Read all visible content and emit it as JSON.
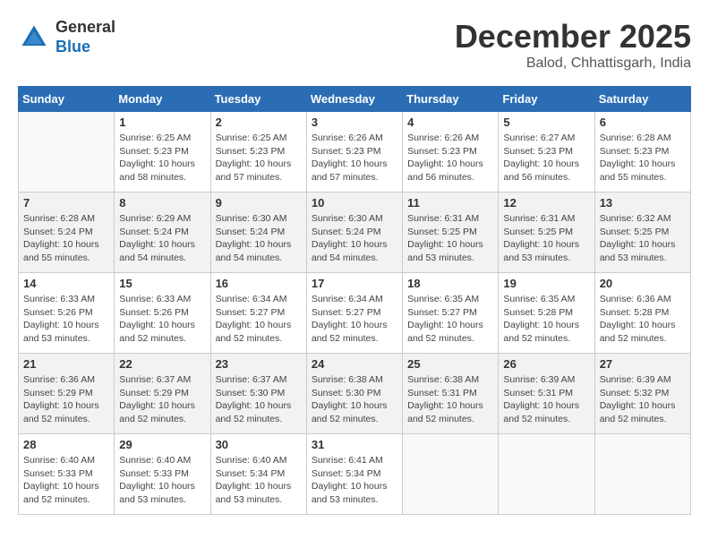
{
  "logo": {
    "general": "General",
    "blue": "Blue"
  },
  "title": {
    "month_year": "December 2025",
    "location": "Balod, Chhattisgarh, India"
  },
  "headers": [
    "Sunday",
    "Monday",
    "Tuesday",
    "Wednesday",
    "Thursday",
    "Friday",
    "Saturday"
  ],
  "weeks": [
    [
      {
        "day": "",
        "sunrise": "",
        "sunset": "",
        "daylight": ""
      },
      {
        "day": "1",
        "sunrise": "Sunrise: 6:25 AM",
        "sunset": "Sunset: 5:23 PM",
        "daylight": "Daylight: 10 hours and 58 minutes."
      },
      {
        "day": "2",
        "sunrise": "Sunrise: 6:25 AM",
        "sunset": "Sunset: 5:23 PM",
        "daylight": "Daylight: 10 hours and 57 minutes."
      },
      {
        "day": "3",
        "sunrise": "Sunrise: 6:26 AM",
        "sunset": "Sunset: 5:23 PM",
        "daylight": "Daylight: 10 hours and 57 minutes."
      },
      {
        "day": "4",
        "sunrise": "Sunrise: 6:26 AM",
        "sunset": "Sunset: 5:23 PM",
        "daylight": "Daylight: 10 hours and 56 minutes."
      },
      {
        "day": "5",
        "sunrise": "Sunrise: 6:27 AM",
        "sunset": "Sunset: 5:23 PM",
        "daylight": "Daylight: 10 hours and 56 minutes."
      },
      {
        "day": "6",
        "sunrise": "Sunrise: 6:28 AM",
        "sunset": "Sunset: 5:23 PM",
        "daylight": "Daylight: 10 hours and 55 minutes."
      }
    ],
    [
      {
        "day": "7",
        "sunrise": "Sunrise: 6:28 AM",
        "sunset": "Sunset: 5:24 PM",
        "daylight": "Daylight: 10 hours and 55 minutes."
      },
      {
        "day": "8",
        "sunrise": "Sunrise: 6:29 AM",
        "sunset": "Sunset: 5:24 PM",
        "daylight": "Daylight: 10 hours and 54 minutes."
      },
      {
        "day": "9",
        "sunrise": "Sunrise: 6:30 AM",
        "sunset": "Sunset: 5:24 PM",
        "daylight": "Daylight: 10 hours and 54 minutes."
      },
      {
        "day": "10",
        "sunrise": "Sunrise: 6:30 AM",
        "sunset": "Sunset: 5:24 PM",
        "daylight": "Daylight: 10 hours and 54 minutes."
      },
      {
        "day": "11",
        "sunrise": "Sunrise: 6:31 AM",
        "sunset": "Sunset: 5:25 PM",
        "daylight": "Daylight: 10 hours and 53 minutes."
      },
      {
        "day": "12",
        "sunrise": "Sunrise: 6:31 AM",
        "sunset": "Sunset: 5:25 PM",
        "daylight": "Daylight: 10 hours and 53 minutes."
      },
      {
        "day": "13",
        "sunrise": "Sunrise: 6:32 AM",
        "sunset": "Sunset: 5:25 PM",
        "daylight": "Daylight: 10 hours and 53 minutes."
      }
    ],
    [
      {
        "day": "14",
        "sunrise": "Sunrise: 6:33 AM",
        "sunset": "Sunset: 5:26 PM",
        "daylight": "Daylight: 10 hours and 53 minutes."
      },
      {
        "day": "15",
        "sunrise": "Sunrise: 6:33 AM",
        "sunset": "Sunset: 5:26 PM",
        "daylight": "Daylight: 10 hours and 52 minutes."
      },
      {
        "day": "16",
        "sunrise": "Sunrise: 6:34 AM",
        "sunset": "Sunset: 5:27 PM",
        "daylight": "Daylight: 10 hours and 52 minutes."
      },
      {
        "day": "17",
        "sunrise": "Sunrise: 6:34 AM",
        "sunset": "Sunset: 5:27 PM",
        "daylight": "Daylight: 10 hours and 52 minutes."
      },
      {
        "day": "18",
        "sunrise": "Sunrise: 6:35 AM",
        "sunset": "Sunset: 5:27 PM",
        "daylight": "Daylight: 10 hours and 52 minutes."
      },
      {
        "day": "19",
        "sunrise": "Sunrise: 6:35 AM",
        "sunset": "Sunset: 5:28 PM",
        "daylight": "Daylight: 10 hours and 52 minutes."
      },
      {
        "day": "20",
        "sunrise": "Sunrise: 6:36 AM",
        "sunset": "Sunset: 5:28 PM",
        "daylight": "Daylight: 10 hours and 52 minutes."
      }
    ],
    [
      {
        "day": "21",
        "sunrise": "Sunrise: 6:36 AM",
        "sunset": "Sunset: 5:29 PM",
        "daylight": "Daylight: 10 hours and 52 minutes."
      },
      {
        "day": "22",
        "sunrise": "Sunrise: 6:37 AM",
        "sunset": "Sunset: 5:29 PM",
        "daylight": "Daylight: 10 hours and 52 minutes."
      },
      {
        "day": "23",
        "sunrise": "Sunrise: 6:37 AM",
        "sunset": "Sunset: 5:30 PM",
        "daylight": "Daylight: 10 hours and 52 minutes."
      },
      {
        "day": "24",
        "sunrise": "Sunrise: 6:38 AM",
        "sunset": "Sunset: 5:30 PM",
        "daylight": "Daylight: 10 hours and 52 minutes."
      },
      {
        "day": "25",
        "sunrise": "Sunrise: 6:38 AM",
        "sunset": "Sunset: 5:31 PM",
        "daylight": "Daylight: 10 hours and 52 minutes."
      },
      {
        "day": "26",
        "sunrise": "Sunrise: 6:39 AM",
        "sunset": "Sunset: 5:31 PM",
        "daylight": "Daylight: 10 hours and 52 minutes."
      },
      {
        "day": "27",
        "sunrise": "Sunrise: 6:39 AM",
        "sunset": "Sunset: 5:32 PM",
        "daylight": "Daylight: 10 hours and 52 minutes."
      }
    ],
    [
      {
        "day": "28",
        "sunrise": "Sunrise: 6:40 AM",
        "sunset": "Sunset: 5:33 PM",
        "daylight": "Daylight: 10 hours and 52 minutes."
      },
      {
        "day": "29",
        "sunrise": "Sunrise: 6:40 AM",
        "sunset": "Sunset: 5:33 PM",
        "daylight": "Daylight: 10 hours and 53 minutes."
      },
      {
        "day": "30",
        "sunrise": "Sunrise: 6:40 AM",
        "sunset": "Sunset: 5:34 PM",
        "daylight": "Daylight: 10 hours and 53 minutes."
      },
      {
        "day": "31",
        "sunrise": "Sunrise: 6:41 AM",
        "sunset": "Sunset: 5:34 PM",
        "daylight": "Daylight: 10 hours and 53 minutes."
      },
      {
        "day": "",
        "sunrise": "",
        "sunset": "",
        "daylight": ""
      },
      {
        "day": "",
        "sunrise": "",
        "sunset": "",
        "daylight": ""
      },
      {
        "day": "",
        "sunrise": "",
        "sunset": "",
        "daylight": ""
      }
    ]
  ]
}
